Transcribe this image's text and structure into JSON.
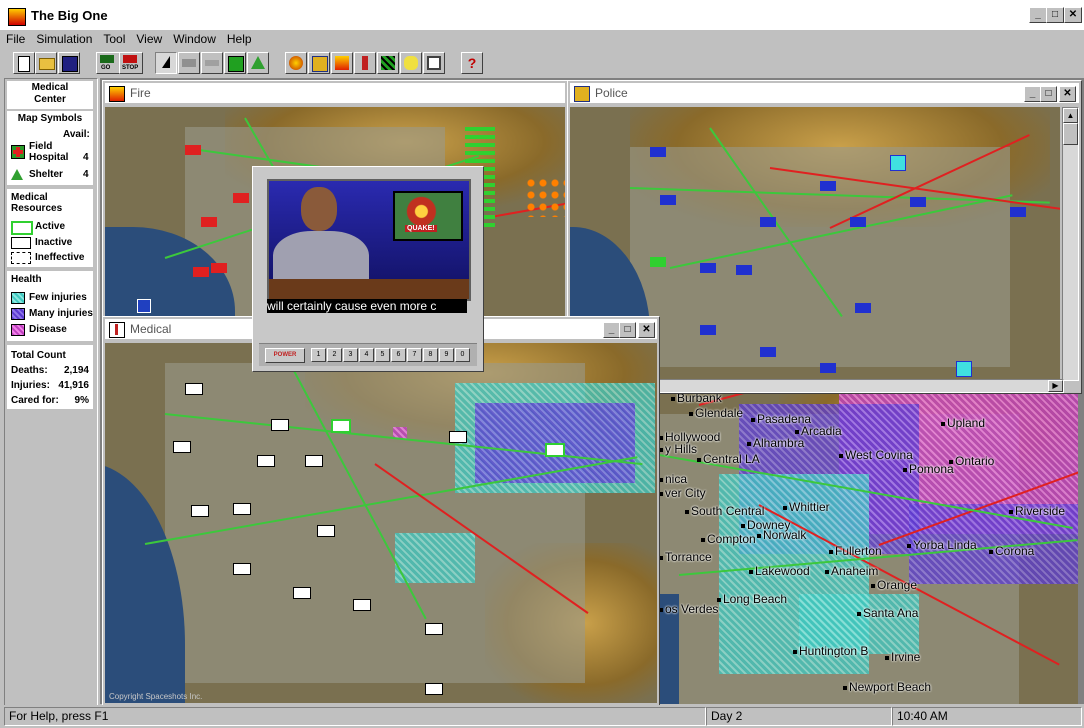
{
  "window": {
    "title": "The Big One",
    "caption_buttons": [
      "_",
      "□",
      "✕"
    ]
  },
  "menu": [
    "File",
    "Simulation",
    "Tool",
    "View",
    "Window",
    "Help"
  ],
  "toolbar": {
    "go_label": "GO",
    "stop_label": "STOP",
    "help_glyph": "?"
  },
  "sidebar": {
    "title_line1": "Medical",
    "title_line2": "Center",
    "map_symbols": {
      "header": "Map Symbols",
      "avail_label": "Avail:",
      "items": [
        {
          "label_line1": "Field",
          "label_line2": "Hospital",
          "count": "4",
          "icon": "field-hospital-icon"
        },
        {
          "label_line1": "Shelter",
          "label_line2": "",
          "count": "4",
          "icon": "shelter-icon"
        }
      ]
    },
    "resources": {
      "header_line1": "Medical",
      "header_line2": "Resources",
      "items": [
        "Active",
        "Inactive",
        "Ineffective"
      ]
    },
    "health": {
      "header": "Health",
      "items": [
        {
          "label": "Few injuries",
          "color": "#3ec8c0"
        },
        {
          "label": "Many injuries",
          "color": "#5a3ad0"
        },
        {
          "label": "Disease",
          "color": "#c040c0"
        }
      ]
    },
    "totals": {
      "header": "Total Count",
      "deaths_label": "Deaths:",
      "deaths": "2,194",
      "injuries_label": "Injuries:",
      "injuries": "41,916",
      "cared_label": "Cared for:",
      "cared": "9%"
    }
  },
  "windows": {
    "fire": {
      "title": "Fire"
    },
    "police": {
      "title": "Police"
    },
    "medical": {
      "title": "Medical",
      "copyright": "Copyright Spaceshots Inc."
    }
  },
  "news": {
    "badge": "QUAKE!",
    "ticker": "will certainly cause even more c",
    "power_label": "POWER",
    "channels": [
      "1",
      "2",
      "3",
      "4",
      "5",
      "6",
      "7",
      "8",
      "9",
      "0"
    ]
  },
  "map_labels": [
    "Burbank",
    "Glendale",
    "Pasadena",
    "Arcadia",
    "Hollywood",
    "Alhambra",
    "y Hills",
    "Central LA",
    "West Covina",
    "Upland",
    "Ontario",
    "Pomona",
    "nica",
    "ver City",
    "Whittier",
    "Riverside",
    "South Central",
    "Downey",
    "Compton",
    "Norwalk",
    "Fullerton",
    "Yorba Linda",
    "Corona",
    "Torrance",
    "Lakewood",
    "Anaheim",
    "Orange",
    "Long Beach",
    "os Verdes",
    "Santa Ana",
    "Huntington B",
    "Irvine",
    "Newport Beach"
  ],
  "status": {
    "help": "For Help, press F1",
    "day": "Day 2",
    "time": "10:40 AM"
  },
  "colors": {
    "active_unit": "#30d030",
    "fire_unit": "#e02020",
    "police_unit": "#2030d0",
    "road": "#3cc83c",
    "fault": "#e02020"
  }
}
